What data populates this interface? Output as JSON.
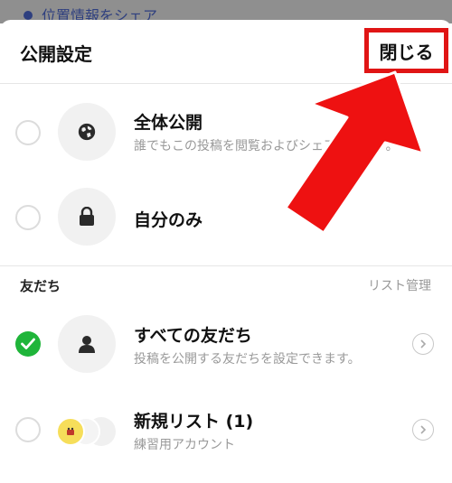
{
  "backdrop": {
    "text": "位置情報をシェア"
  },
  "header": {
    "title": "公開設定",
    "close_label": "閉じる"
  },
  "visibility_options": [
    {
      "title": "全体公開",
      "subtitle": "誰でもこの投稿を閲覧およびシェアできます。",
      "icon": "globe-icon",
      "selected": false
    },
    {
      "title": "自分のみ",
      "subtitle": "",
      "icon": "lock-icon",
      "selected": false
    }
  ],
  "friends_section": {
    "label": "友だち",
    "manage_label": "リスト管理",
    "items": [
      {
        "title": "すべての友だち",
        "subtitle": "投稿を公開する友だちを設定できます。",
        "icon": "person-icon",
        "selected": true
      },
      {
        "title": "新規リスト (1)",
        "subtitle": "練習用アカウント",
        "icon": "avatar-group-icon",
        "selected": false
      }
    ]
  },
  "colors": {
    "accent_green": "#1fb53a",
    "highlight_red": "#e01515"
  }
}
